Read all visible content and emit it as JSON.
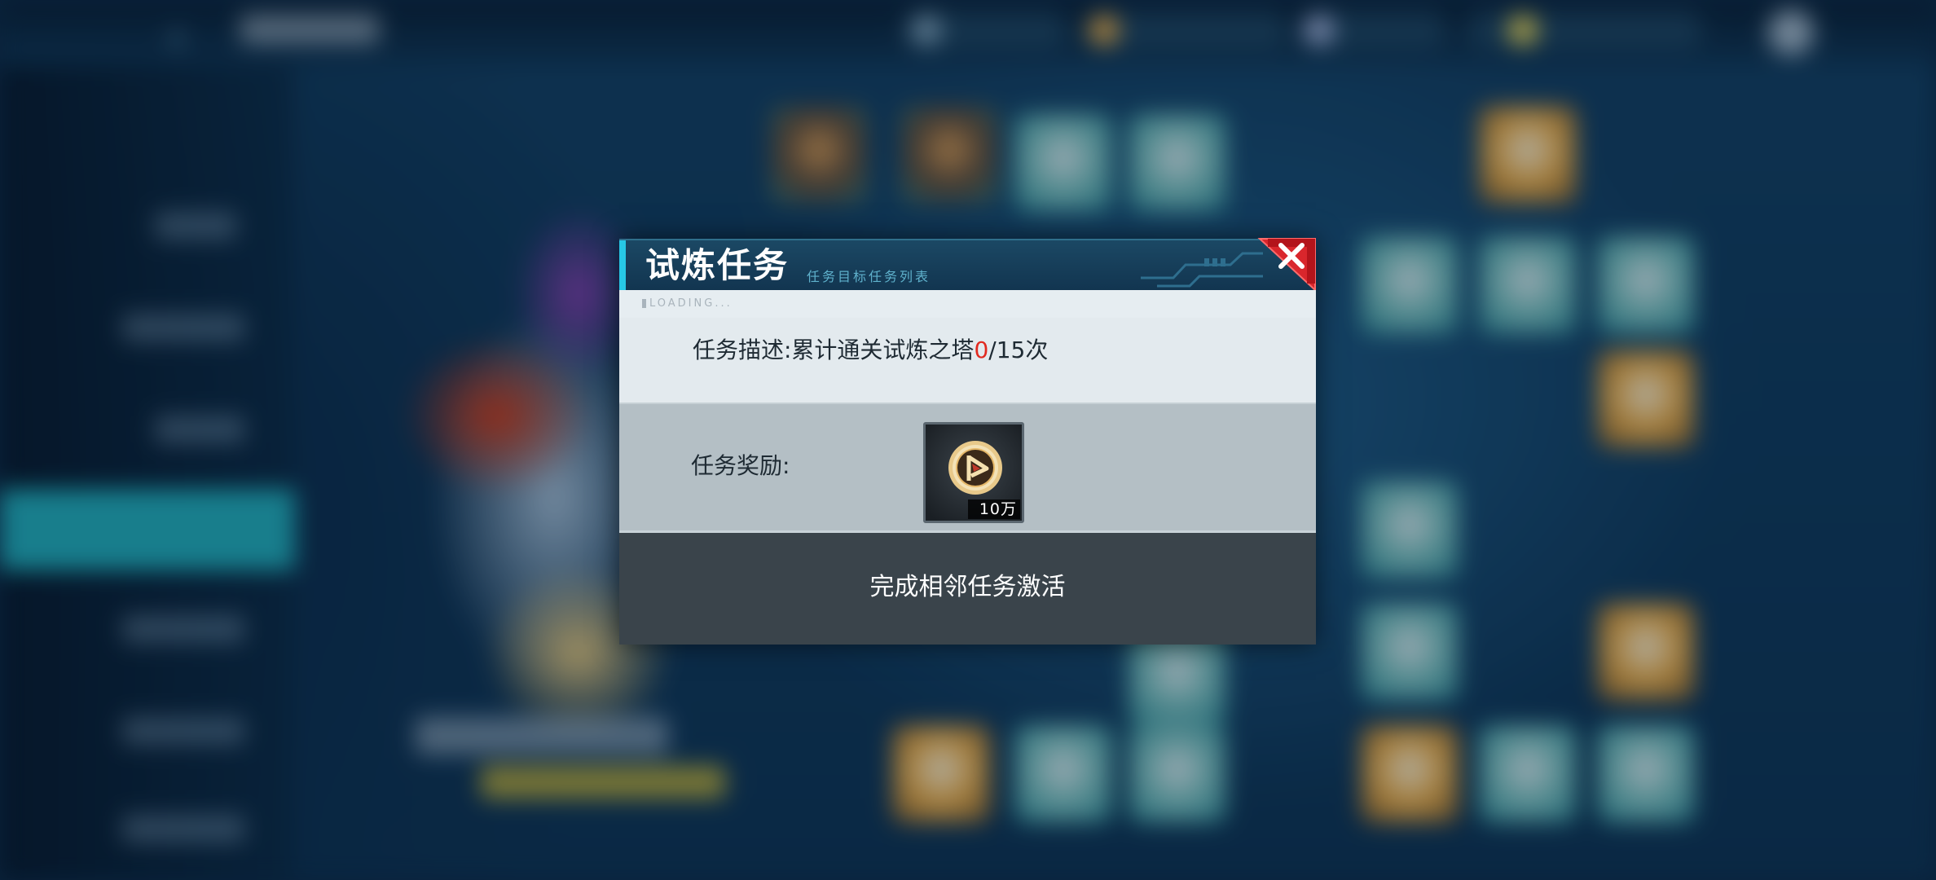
{
  "dialog": {
    "title": "试炼任务",
    "header_deco_text": "任务目标任务列表",
    "loading_label": "LOADING...",
    "description_prefix": "任务描述:累计通关试炼之塔",
    "description_current": "0",
    "description_total": "/15次",
    "reward_label": "任务奖励:",
    "reward_item": {
      "icon": "gold-coin-icon",
      "quantity": "10万"
    },
    "status_text": "完成相邻任务激活",
    "close_icon": "close-icon"
  },
  "colors": {
    "accent_cyan": "#27c8e6",
    "close_red": "#d9262c",
    "progress_red": "#e12a20",
    "footer_bg": "#3a444b"
  }
}
